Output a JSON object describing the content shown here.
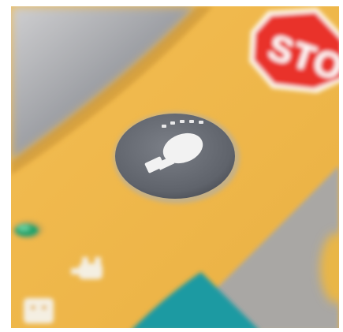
{
  "photo": {
    "subject": "control-panel-closeup",
    "stop_sign": {
      "label": "STOP",
      "color": "#e9312c"
    },
    "panel_color": "#f0b84a",
    "icons": [
      "light-bulb-icon",
      "plug-icon",
      "status-led",
      "socket-icon"
    ],
    "colors": {
      "bulb_button": "#6c7078",
      "led": "#27a36a",
      "teal_strip": "#1c9aa2",
      "gray_panel": "#a9a7a4"
    }
  }
}
